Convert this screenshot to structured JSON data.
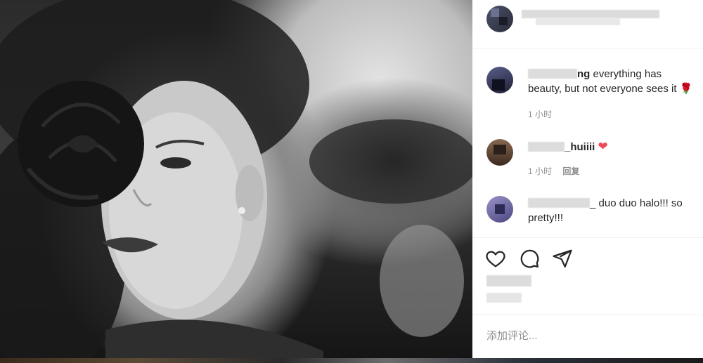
{
  "comments": [
    {
      "username_tail": "ng",
      "text_line1": " everything has",
      "text_line2": "beauty, but not everyone sees it ",
      "emoji": "🌹",
      "time": "1 小时"
    },
    {
      "username_tail": "_huiiii",
      "emoji": "❤",
      "time": "1 小时",
      "reply_label": "回复"
    },
    {
      "username_tail": "_",
      "text_line1": " duo duo halo!!! so",
      "text_line2": "pretty!!!"
    }
  ],
  "add_comment": {
    "placeholder": "添加评论..."
  },
  "colors": {
    "text": "#262626",
    "secondary": "#8e8e8e",
    "heart_red": "#ed4956",
    "divider": "#efefef"
  }
}
